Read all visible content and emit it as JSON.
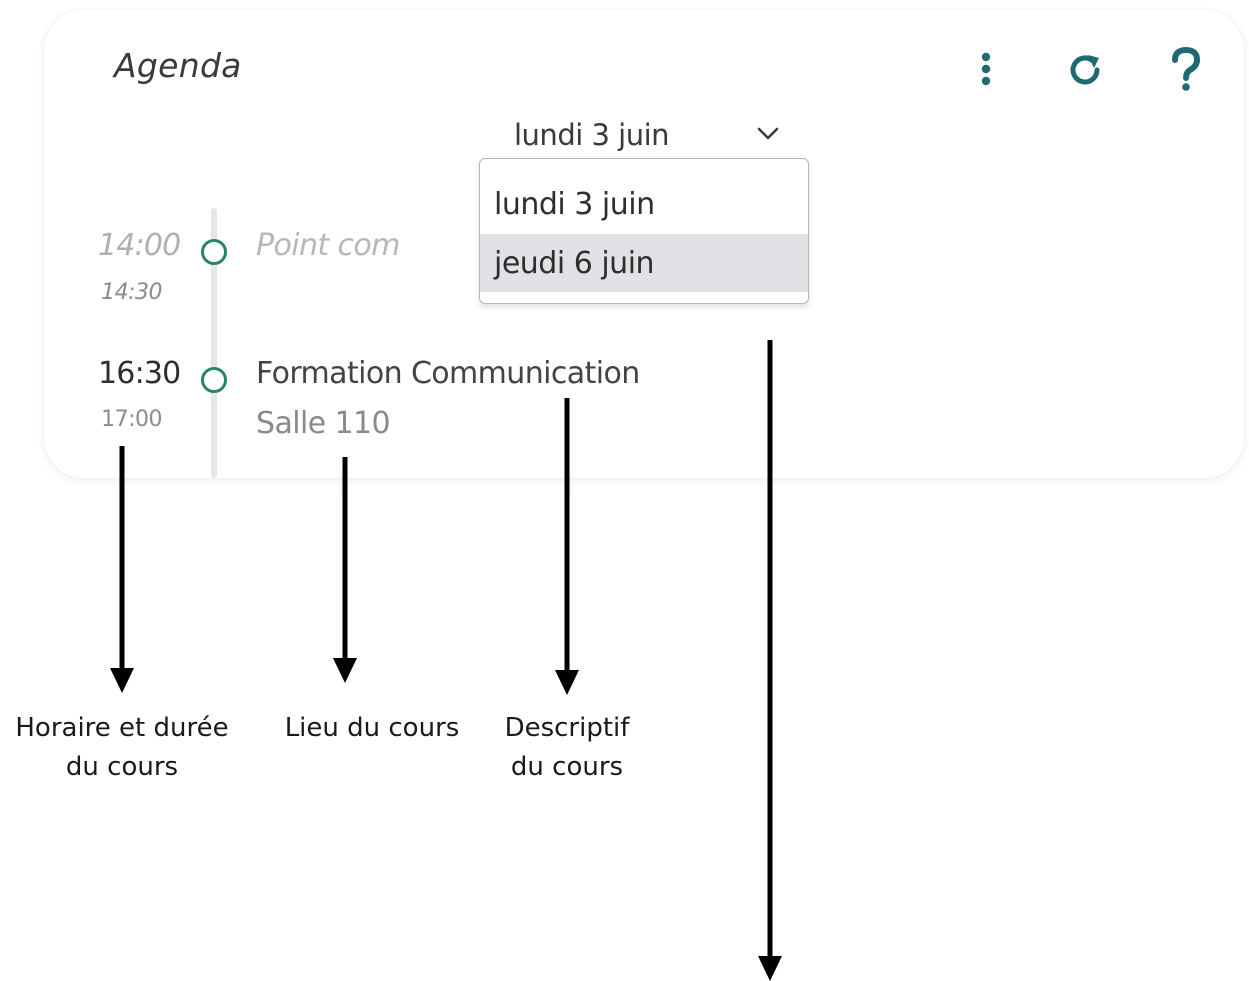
{
  "widget": {
    "title": "Agenda",
    "icons": {
      "menu": "kebab-menu-icon",
      "refresh": "refresh-icon",
      "help": "help-icon"
    },
    "accent_color": "#2a8560",
    "icon_color": "#1f6a72"
  },
  "date_select": {
    "selected": "lundi 3 juin",
    "options": [
      "lundi 3 juin",
      "jeudi 6 juin"
    ],
    "highlighted_option": "jeudi 6 juin"
  },
  "events": [
    {
      "start": "14:00",
      "end": "14:30",
      "title": "Point com",
      "location": "",
      "state": "past"
    },
    {
      "start": "16:30",
      "end": "17:00",
      "title": "Formation Communication",
      "location": "Salle 110",
      "state": "current"
    }
  ],
  "annotations": {
    "schedule": [
      "Horaire et durée",
      "du cours"
    ],
    "location": [
      "Lieu du cours"
    ],
    "description": [
      "Descriptif",
      "du cours"
    ]
  }
}
